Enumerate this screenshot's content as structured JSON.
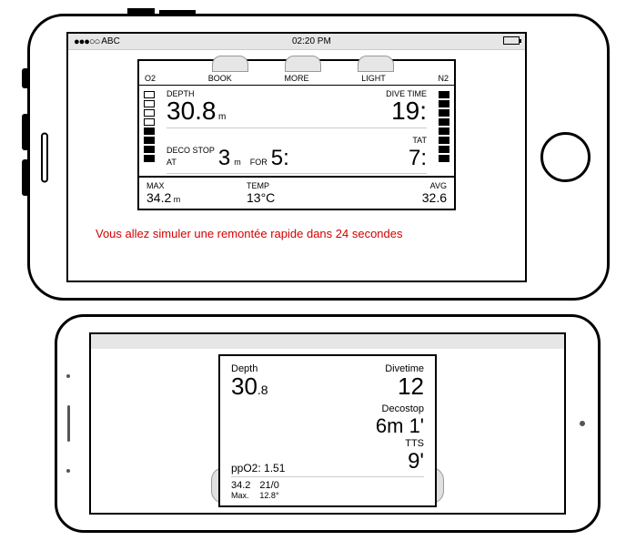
{
  "statusbar": {
    "signal": "●●●○○",
    "carrier": "ABC",
    "time": "02:20 PM"
  },
  "watch1": {
    "tab_o2": "O2",
    "tab_book": "BOOK",
    "tab_more": "MORE",
    "tab_light": "LIGHT",
    "tab_n2": "N2",
    "depth_label": "DEPTH",
    "depth_value": "30.8",
    "depth_unit": "m",
    "divetime_label": "DIVE TIME",
    "divetime_value": "19:",
    "deco_label": "DECO STOP",
    "deco_at_label": "AT",
    "deco_at_value": "3",
    "deco_at_unit": "m",
    "deco_for_label": "FOR",
    "deco_for_value": "5:",
    "tat_label": "TAT",
    "tat_value": "7:",
    "max_label": "MAX",
    "max_value": "34.2",
    "max_unit": "m",
    "temp_label": "TEMP",
    "temp_value": "13°C",
    "avg_label": "AVG",
    "avg_value": "32.6"
  },
  "alert_text": "Vous allez simuler une remontée rapide dans 24 secondes",
  "watch2": {
    "depth_label": "Depth",
    "depth_value": "30",
    "depth_dec": ".8",
    "divetime_label": "Divetime",
    "divetime_value": "12",
    "decostop_label": "Decostop",
    "decostop_value": "6m 1'",
    "ppo2_label": "ppO2:",
    "ppo2_value": "1.51",
    "tts_label": "TTS",
    "tts_value": "9'",
    "max_value": "34.2",
    "max_label": "Max.",
    "mix_value": "21/0",
    "temp_value": "12.8°"
  }
}
